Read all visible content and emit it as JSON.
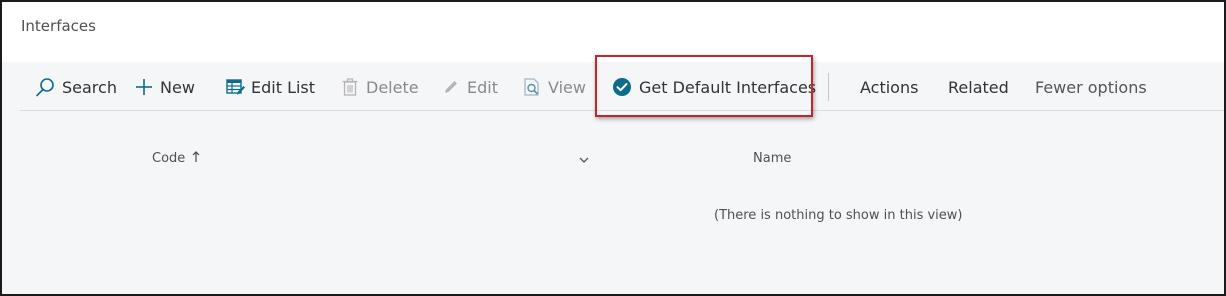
{
  "page": {
    "title": "Interfaces"
  },
  "toolbar": {
    "search": "Search",
    "new": "New",
    "edit_list": "Edit List",
    "delete": "Delete",
    "edit": "Edit",
    "view": "View",
    "get_default_interfaces": "Get Default Interfaces",
    "actions": "Actions",
    "related": "Related",
    "fewer_options": "Fewer options"
  },
  "list": {
    "columns": [
      {
        "label": "Code",
        "sort": "ascending"
      },
      {
        "label": "Name"
      }
    ],
    "empty_message": "(There is nothing to show in this view)"
  },
  "colors": {
    "accent": "#0f6b8b",
    "highlight_box": "#c0272d",
    "disabled_icon": "#b5b5b5"
  }
}
